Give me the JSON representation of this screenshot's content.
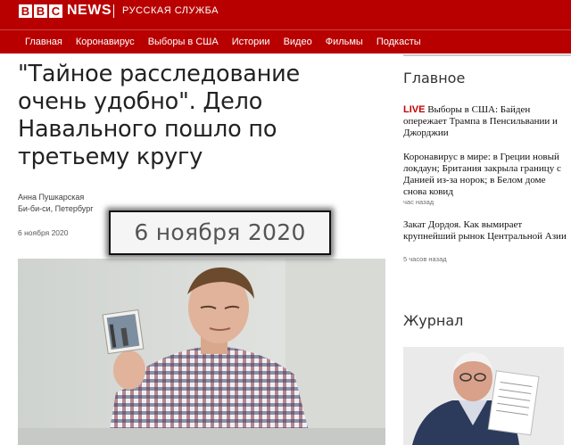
{
  "header": {
    "logo_letters": [
      "B",
      "B",
      "C"
    ],
    "news_label": "NEWS",
    "service_label": "РУССКАЯ СЛУЖБА",
    "brand_color": "#b80000"
  },
  "nav": {
    "items": [
      {
        "label": "Главная"
      },
      {
        "label": "Коронавирус"
      },
      {
        "label": "Выборы в США"
      },
      {
        "label": "Истории"
      },
      {
        "label": "Видео"
      },
      {
        "label": "Фильмы"
      },
      {
        "label": "Подкасты"
      }
    ]
  },
  "article": {
    "headline": "\"Тайное расследование очень удобно\". Дело Навального пошло по третьему кругу",
    "author": "Анна Пушкарская",
    "author_org": "Би-би-си, Петербург",
    "published": "6 ноября 2020",
    "date_overlay": "6 ноября 2020"
  },
  "sidebar": {
    "main_title": "Главное",
    "stories": [
      {
        "live": "LIVE",
        "title": " Выборы в США: Байден опережает Трампа в Пенсильвании и Джорджии",
        "time": ""
      },
      {
        "live": "",
        "title": "Коронавирус в мире: в Греции новый локдаун; Британия закрыла границу с Данией из-за норок; в Белом доме снова ковид",
        "time": "час назад"
      },
      {
        "live": "",
        "title": "Закат Дордоя. Как вымирает крупнейший рынок Центральной Азии",
        "time": "5 часов назад"
      }
    ],
    "journal_title": "Журнал",
    "live_color": "#c00000"
  }
}
